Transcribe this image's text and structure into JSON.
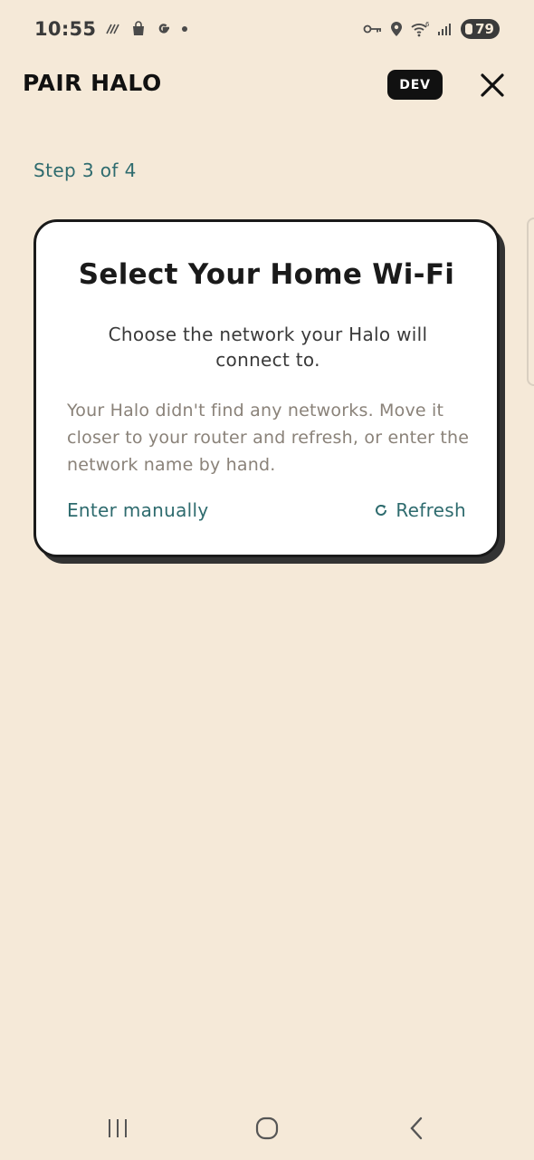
{
  "status_bar": {
    "time": "10:55",
    "battery": "79",
    "left_icons": [
      "diagonal-lines-icon",
      "shopping-bag-icon",
      "google-g-icon",
      "dot-icon"
    ],
    "right_icons": [
      "key-icon",
      "location-icon",
      "wifi-icon",
      "signal-icon",
      "battery-icon"
    ]
  },
  "header": {
    "title": "PAIR HALO",
    "badge": "DEV",
    "close_icon": "close-icon"
  },
  "step_label": "Step 3 of 4",
  "card": {
    "title": "Select Your Home Wi-Fi",
    "subtitle": "Choose the network your Halo will connect to.",
    "message": "Your Halo didn't find any networks. Move it closer to your router and refresh, or enter the network name by hand.",
    "enter_manually_label": "Enter manually",
    "refresh_label": "Refresh",
    "refresh_icon": "refresh-icon"
  },
  "colors": {
    "background": "#f5e9d8",
    "accent": "#2e6b6e",
    "card": "#ffffff",
    "muted_text": "#8a8279"
  },
  "nav_bar": {
    "icons": [
      "recent-apps-icon",
      "home-icon",
      "back-icon"
    ]
  }
}
